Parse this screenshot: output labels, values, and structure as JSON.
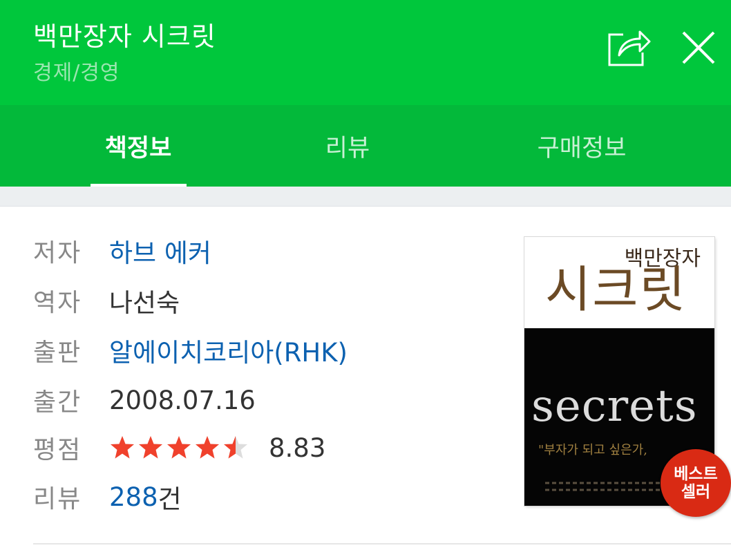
{
  "header": {
    "title": "백만장자 시크릿",
    "category": "경제/경영"
  },
  "tabs": [
    {
      "label": "책정보",
      "active": true
    },
    {
      "label": "리뷰",
      "active": false
    },
    {
      "label": "구매정보",
      "active": false
    }
  ],
  "book": {
    "author_label": "저자",
    "author": "하브 에커",
    "translator_label": "역자",
    "translator": "나선숙",
    "publisher_label": "출판",
    "publisher": "알에이치코리아(RHK)",
    "date_label": "출간",
    "date": "2008.07.16",
    "rating_label": "평점",
    "rating": "8.83",
    "rating_stars": 4.5,
    "review_label": "리뷰",
    "review_count": "288",
    "review_unit": "건"
  },
  "cover": {
    "line1": "백만장자",
    "line2": "시크릿",
    "english": "secrets",
    "quote": "\"부자가 되고 싶은가,"
  },
  "badge": {
    "line1": "베스트",
    "line2": "셀러"
  },
  "colors": {
    "header_green": "#00c73c",
    "tab_green": "#03b93a",
    "link_blue": "#0c61b0",
    "star_red": "#f0412c",
    "badge_red": "#d92a14"
  },
  "icons": [
    "share-icon",
    "close-icon",
    "star-icon"
  ]
}
